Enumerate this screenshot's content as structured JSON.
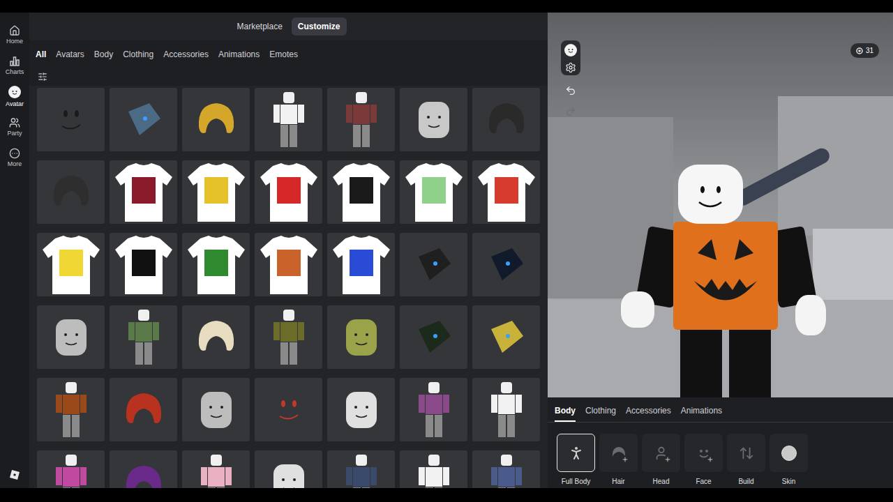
{
  "nav": [
    {
      "label": "Home",
      "kind": "home",
      "selected": false
    },
    {
      "label": "Charts",
      "kind": "charts",
      "selected": false
    },
    {
      "label": "Avatar",
      "kind": "avatar",
      "selected": true
    },
    {
      "label": "Party",
      "kind": "party",
      "selected": false
    },
    {
      "label": "More",
      "kind": "more",
      "selected": false
    }
  ],
  "top_tabs": [
    {
      "label": "Marketplace",
      "selected": false
    },
    {
      "label": "Customize",
      "selected": true
    }
  ],
  "tabs": [
    {
      "label": "All",
      "selected": true
    },
    {
      "label": "Avatars",
      "selected": false
    },
    {
      "label": "Body",
      "selected": false
    },
    {
      "label": "Clothing",
      "selected": false
    },
    {
      "label": "Accessories",
      "selected": false
    },
    {
      "label": "Animations",
      "selected": false
    },
    {
      "label": "Emotes",
      "selected": false
    }
  ],
  "items": [
    {
      "kind": "face",
      "color": "#1b1b1b"
    },
    {
      "kind": "accessory",
      "color": "#4a6a86"
    },
    {
      "kind": "hair",
      "color": "#d4a62a"
    },
    {
      "kind": "figure",
      "color": "#f2f2f2"
    },
    {
      "kind": "figure",
      "color": "#7a3a3a"
    },
    {
      "kind": "head",
      "color": "#c8c8c8"
    },
    {
      "kind": "hair",
      "color": "#2a2a2a"
    },
    {
      "kind": "hair",
      "color": "#2e2e2e"
    },
    {
      "kind": "tshirt",
      "color": "#8b1a2a"
    },
    {
      "kind": "tshirt",
      "color": "#e6c229"
    },
    {
      "kind": "tshirt",
      "color": "#d62828"
    },
    {
      "kind": "tshirt",
      "color": "#1a1a1a"
    },
    {
      "kind": "tshirt",
      "color": "#8fd18b"
    },
    {
      "kind": "tshirt",
      "color": "#d63b2e"
    },
    {
      "kind": "tshirt",
      "color": "#f1d733"
    },
    {
      "kind": "tshirt",
      "color": "#111111"
    },
    {
      "kind": "tshirt",
      "color": "#2f8a2f"
    },
    {
      "kind": "tshirt",
      "color": "#c9622b"
    },
    {
      "kind": "tshirt",
      "color": "#2a4bd6"
    },
    {
      "kind": "accessory",
      "color": "#1f1f1f"
    },
    {
      "kind": "accessory",
      "color": "#101a2a"
    },
    {
      "kind": "head",
      "color": "#bdbdbd"
    },
    {
      "kind": "figure",
      "color": "#5a7a4a"
    },
    {
      "kind": "hair",
      "color": "#e7dcc0"
    },
    {
      "kind": "figure",
      "color": "#6b6b2a"
    },
    {
      "kind": "head",
      "color": "#9aa34a"
    },
    {
      "kind": "accessory",
      "color": "#1c2a1c"
    },
    {
      "kind": "accessory",
      "color": "#c9b23a"
    },
    {
      "kind": "figure",
      "color": "#9a4a1a"
    },
    {
      "kind": "hair",
      "color": "#b8321f"
    },
    {
      "kind": "head",
      "color": "#bdbdbd"
    },
    {
      "kind": "face",
      "color": "#c0392b"
    },
    {
      "kind": "head",
      "color": "#e0e0e0"
    },
    {
      "kind": "figure",
      "color": "#8a4a8a"
    },
    {
      "kind": "figure",
      "color": "#f2f2f2"
    },
    {
      "kind": "figure",
      "color": "#c04aa0"
    },
    {
      "kind": "hair",
      "color": "#6a2a8a"
    },
    {
      "kind": "figure",
      "color": "#e8b0c0"
    },
    {
      "kind": "head",
      "color": "#e0e0e0"
    },
    {
      "kind": "figure",
      "color": "#3a4a6a"
    },
    {
      "kind": "figure",
      "color": "#f2f2f2"
    },
    {
      "kind": "figure",
      "color": "#4a5a8a"
    }
  ],
  "viewport": {
    "robux": "31",
    "tools": [
      {
        "kind": "undo",
        "disabled": false
      },
      {
        "kind": "redo",
        "disabled": true
      }
    ]
  },
  "editor_tabs": [
    {
      "label": "Body",
      "selected": true
    },
    {
      "label": "Clothing",
      "selected": false
    },
    {
      "label": "Accessories",
      "selected": false
    },
    {
      "label": "Animations",
      "selected": false
    }
  ],
  "body_parts": [
    {
      "label": "Full Body",
      "kind": "figure",
      "add": false,
      "selected": true
    },
    {
      "label": "Hair",
      "kind": "hair",
      "add": true,
      "selected": false
    },
    {
      "label": "Head",
      "kind": "head",
      "add": true,
      "selected": false
    },
    {
      "label": "Face",
      "kind": "face",
      "add": true,
      "selected": false
    },
    {
      "label": "Build",
      "kind": "build",
      "add": false,
      "selected": false
    },
    {
      "label": "Skin",
      "kind": "swatch",
      "add": false,
      "selected": false,
      "color": "#c9c9c9"
    }
  ]
}
